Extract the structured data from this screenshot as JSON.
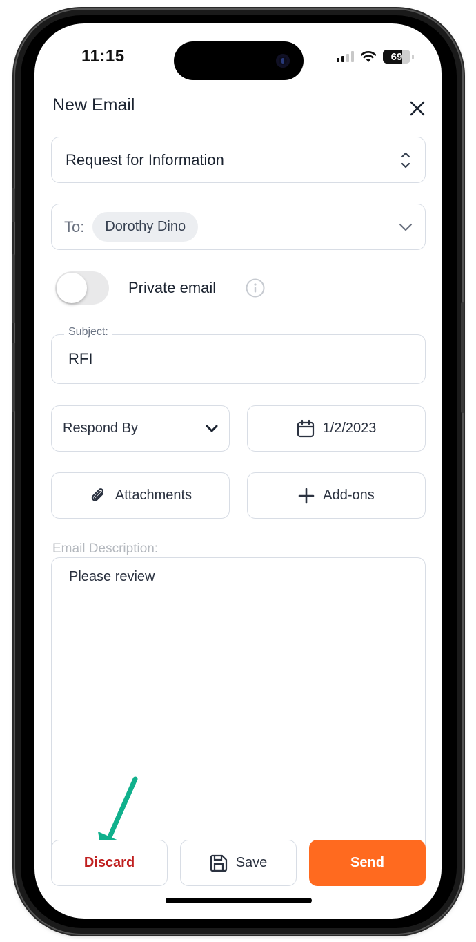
{
  "status_bar": {
    "time": "11:15",
    "battery_level": 69,
    "battery_label": "69",
    "signal_bars_active": 2,
    "signal_bars_total": 4,
    "icons": [
      "cellular-signal-icon",
      "wifi-icon",
      "battery-icon"
    ]
  },
  "header": {
    "title": "New Email",
    "close_icon": "close-icon"
  },
  "email_type": {
    "value": "Request for Information",
    "icon": "chevron-up-down-icon"
  },
  "recipients": {
    "label": "To:",
    "chips": [
      "Dorothy Dino"
    ],
    "icon": "chevron-down-icon"
  },
  "private_toggle": {
    "label": "Private email",
    "on": false,
    "info_icon": "info-icon"
  },
  "subject": {
    "label": "Subject:",
    "value": "RFI"
  },
  "respond_by": {
    "label": "Respond By",
    "icon": "chevron-down-icon"
  },
  "due_date": {
    "value": "1/2/2023",
    "icon": "calendar-icon"
  },
  "attachments": {
    "label": "Attachments",
    "icon": "paperclip-icon"
  },
  "addons": {
    "label": "Add-ons",
    "icon": "plus-icon"
  },
  "description": {
    "label": "Email Description:",
    "value": "Please review"
  },
  "footer": {
    "discard_label": "Discard",
    "save_label": "Save",
    "save_icon": "floppy-disk-icon",
    "send_label": "Send"
  },
  "annotation": {
    "arrow_target": "discard-button",
    "arrow_color": "#10b08c"
  },
  "colors": {
    "accent": "#ff6a1f",
    "danger": "#c02020",
    "border": "#d8dde5",
    "text": "#1b2330"
  }
}
